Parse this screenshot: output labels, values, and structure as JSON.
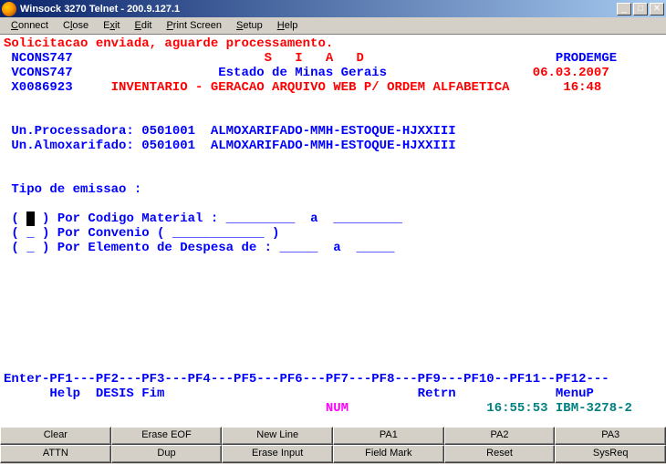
{
  "window": {
    "title": "Winsock 3270 Telnet - 200.9.127.1"
  },
  "menu": {
    "connect": "Connect",
    "close": "Close",
    "exit": "Exit",
    "edit": "Edit",
    "print": "Print Screen",
    "setup": "Setup",
    "help": "Help"
  },
  "screen": {
    "l1": "Solicitacao enviada, aguarde processamento.",
    "l2a": " NCONS747",
    "l2b": "                         S",
    "l2c": "   I",
    "l2d": "   A",
    "l2e": "   D",
    "l2f": "                         PRODEMGE",
    "l3a": " VCONS747",
    "l3b": "                   Estado de Minas Gerais",
    "l3c": "                   06.03.2007",
    "l4a": " X0086923",
    "l4b": "     INVENTARIO - GERACAO ARQUIVO WEB P/ ORDEM ALFABETICA",
    "l4c": "       16:48",
    "l7": " Un.Processadora: 0501001  ALMOXARIFADO-MMH-ESTOQUE-HJXXIII",
    "l8": " Un.Almoxarifado: 0501001  ALMOXARIFADO-MMH-ESTOQUE-HJXXIII",
    "l11": " Tipo de emissao :",
    "l13a": " ( ",
    "l13cur": " ",
    "l13b": " ) Por Codigo Material : _________  a  _________",
    "l14": " ( _ ) Por Convenio ( ____________ )",
    "l15": " ( _ ) Por Elemento de Despesa de : _____  a  _____",
    "l25": "Enter-PF1---PF2---PF3---PF4---PF5---PF6---PF7---PF8---PF9---PF10--PF11--PF12---",
    "l26": "      Help  DESIS Fim                                 Retrn             MenuP",
    "l27a": "                                          NUM",
    "l27b": "                  16:55:53 IBM-3278-2"
  },
  "buttons": {
    "row1": [
      "Clear",
      "Erase EOF",
      "New Line",
      "PA1",
      "PA2",
      "PA3"
    ],
    "row2": [
      "ATTN",
      "Dup",
      "Erase Input",
      "Field Mark",
      "Reset",
      "SysReq"
    ]
  }
}
